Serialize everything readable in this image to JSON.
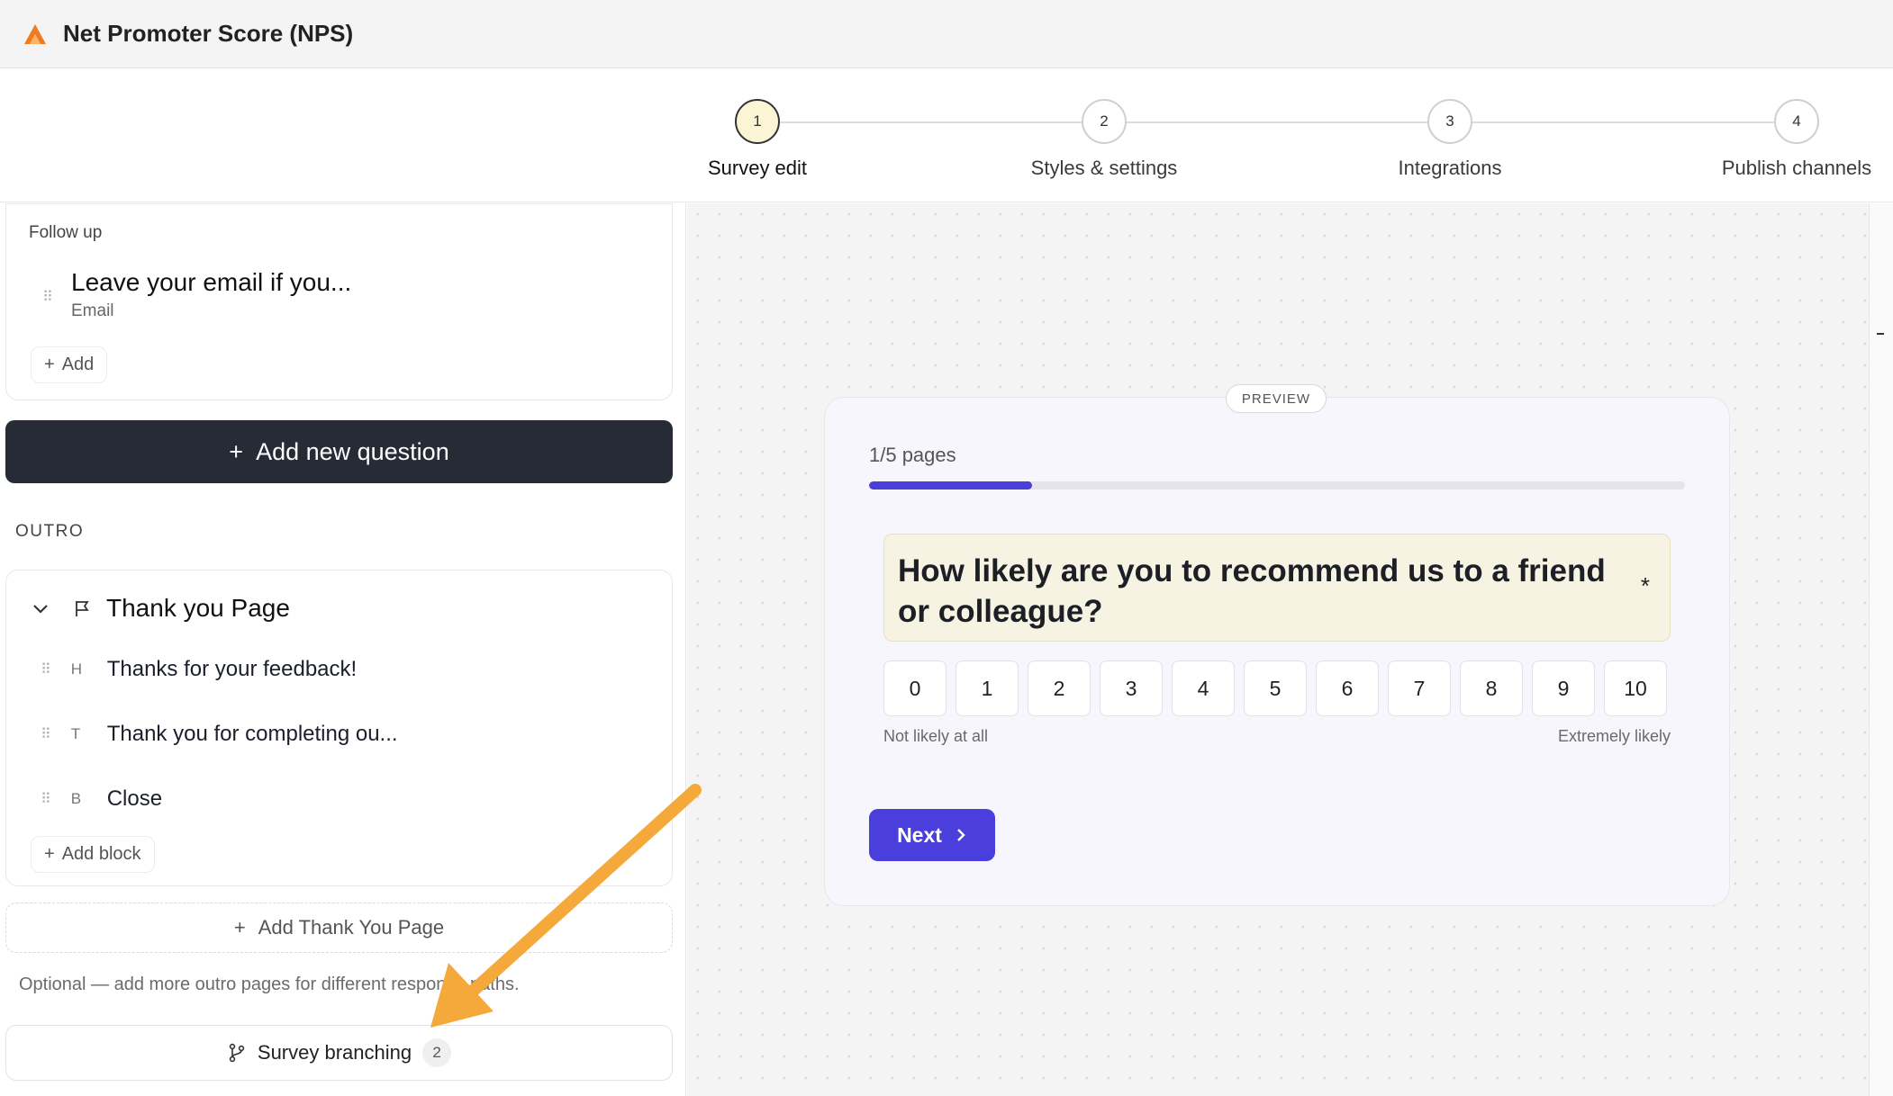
{
  "app": {
    "title": "Net Promoter Score (NPS)",
    "logo_icon": "brand-logo-icon",
    "accent_color": "#f07a1e"
  },
  "stepper": {
    "steps": [
      {
        "number": "1",
        "label": "Survey edit",
        "active": true
      },
      {
        "number": "2",
        "label": "Styles & settings",
        "active": false
      },
      {
        "number": "3",
        "label": "Integrations",
        "active": false
      },
      {
        "number": "4",
        "label": "Publish channels",
        "active": false
      }
    ]
  },
  "left_panel": {
    "follow_up": {
      "section_label": "Follow up",
      "item_title": "Leave your email if you...",
      "item_subtitle": "Email",
      "add_label": "Add"
    },
    "add_question_label": "Add new question",
    "outro": {
      "section_label": "OUTRO",
      "page_title": "Thank you Page",
      "blocks": [
        {
          "type": "H",
          "text": "Thanks for your feedback!"
        },
        {
          "type": "T",
          "text": "Thank you for completing ou..."
        },
        {
          "type": "B",
          "text": "Close"
        }
      ],
      "add_block_label": "Add block"
    },
    "add_thank_you_label": "Add Thank You Page",
    "optional_note": "Optional — add more outro pages for different response paths.",
    "branching": {
      "label": "Survey branching",
      "count": "2"
    }
  },
  "preview": {
    "badge": "PREVIEW",
    "pages_label": "1/5 pages",
    "progress_fraction": 0.2,
    "question": "How likely are you to recommend us to a friend or colleague?",
    "required_mark": "*",
    "scale": [
      "0",
      "1",
      "2",
      "3",
      "4",
      "5",
      "6",
      "7",
      "8",
      "9",
      "10"
    ],
    "low_label": "Not likely at all",
    "high_label": "Extremely likely",
    "next_label": "Next",
    "primary_color": "#4a3fdc"
  },
  "annotation": {
    "arrow_color": "#f5a93a"
  }
}
